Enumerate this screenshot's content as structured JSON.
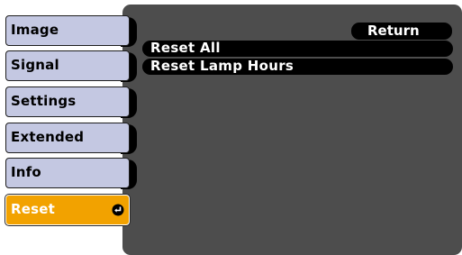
{
  "sidebar": {
    "items": [
      {
        "label": "Image",
        "active": false
      },
      {
        "label": "Signal",
        "active": false
      },
      {
        "label": "Settings",
        "active": false
      },
      {
        "label": "Extended",
        "active": false
      },
      {
        "label": "Info",
        "active": false
      },
      {
        "label": "Reset",
        "active": true,
        "icon": "enter-icon"
      }
    ]
  },
  "main": {
    "return_label": "Return",
    "options": [
      {
        "label": "Reset All"
      },
      {
        "label": "Reset Lamp Hours"
      }
    ]
  },
  "colors": {
    "tab": "#c4c8e2",
    "active_tab": "#f2a200",
    "panel": "#4d4d4d",
    "row": "#000000"
  }
}
